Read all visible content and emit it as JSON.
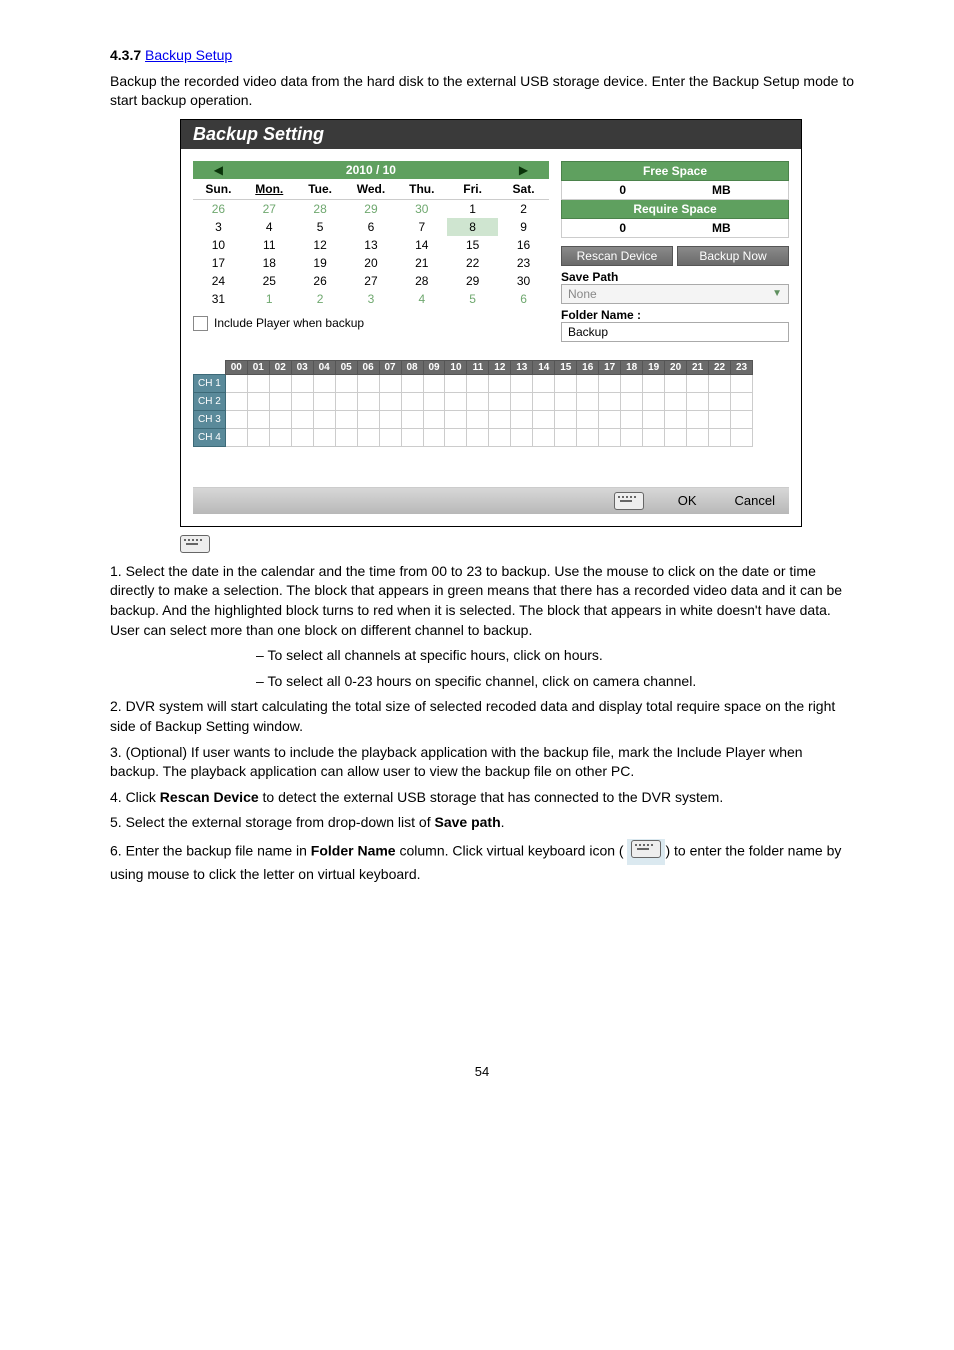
{
  "section": {
    "number": "4.3.7",
    "title_link": "Backup Setup"
  },
  "intro": "Backup the recorded video data from the hard disk to the external USB storage device. Enter the Backup Setup mode to start backup operation.",
  "screenshot": {
    "title": "Backup Setting",
    "calendar": {
      "month_label": "2010 / 10",
      "days": [
        "Sun.",
        "Mon.",
        "Tue.",
        "Wed.",
        "Thu.",
        "Fri.",
        "Sat."
      ],
      "rows": [
        [
          {
            "n": "26",
            "o": true
          },
          {
            "n": "27",
            "o": true
          },
          {
            "n": "28",
            "o": true
          },
          {
            "n": "29",
            "o": true
          },
          {
            "n": "30",
            "o": true
          },
          {
            "n": "1"
          },
          {
            "n": "2"
          }
        ],
        [
          {
            "n": "3"
          },
          {
            "n": "4"
          },
          {
            "n": "5"
          },
          {
            "n": "6"
          },
          {
            "n": "7"
          },
          {
            "n": "8",
            "sel": true
          },
          {
            "n": "9"
          }
        ],
        [
          {
            "n": "10"
          },
          {
            "n": "11"
          },
          {
            "n": "12"
          },
          {
            "n": "13"
          },
          {
            "n": "14"
          },
          {
            "n": "15"
          },
          {
            "n": "16"
          }
        ],
        [
          {
            "n": "17"
          },
          {
            "n": "18"
          },
          {
            "n": "19"
          },
          {
            "n": "20"
          },
          {
            "n": "21"
          },
          {
            "n": "22"
          },
          {
            "n": "23"
          }
        ],
        [
          {
            "n": "24"
          },
          {
            "n": "25"
          },
          {
            "n": "26"
          },
          {
            "n": "27"
          },
          {
            "n": "28"
          },
          {
            "n": "29"
          },
          {
            "n": "30"
          }
        ],
        [
          {
            "n": "31"
          },
          {
            "n": "1",
            "o": true
          },
          {
            "n": "2",
            "o": true
          },
          {
            "n": "3",
            "o": true
          },
          {
            "n": "4",
            "o": true
          },
          {
            "n": "5",
            "o": true
          },
          {
            "n": "6",
            "o": true
          }
        ]
      ]
    },
    "include_player_label": "Include Player when backup",
    "free_space_label": "Free Space",
    "free_space_value": "0",
    "free_space_unit": "MB",
    "require_space_label": "Require Space",
    "require_space_value": "0",
    "require_space_unit": "MB",
    "rescan_btn": "Rescan Device",
    "backup_now_btn": "Backup Now",
    "save_path_label": "Save Path",
    "save_path_value": "None",
    "folder_name_label": "Folder Name :",
    "folder_name_value": "Backup",
    "hours": [
      "00",
      "01",
      "02",
      "03",
      "04",
      "05",
      "06",
      "07",
      "08",
      "09",
      "10",
      "11",
      "12",
      "13",
      "14",
      "15",
      "16",
      "17",
      "18",
      "19",
      "20",
      "21",
      "22",
      "23"
    ],
    "channels": [
      "CH 1",
      "CH 2",
      "CH 3",
      "CH 4"
    ],
    "footer": {
      "ok": "OK",
      "cancel": "Cancel"
    }
  },
  "body": {
    "p1": "1. Select the date in the calendar and the time from 00 to 23 to backup. Use the mouse to click on the date or time directly to make a selection. The block that appears in green means that there has a recorded video data and it can be backup. And the highlighted block turns to red when it is selected. The block that appears in white doesn't have data. User can select more than one block on different channel to backup.",
    "bullet1_dash": "–",
    "bullet1": "To select all channels at specific hours, click on hours.",
    "bullet2_dash": "–",
    "bullet2": "To select all 0-23 hours on specific channel, click on camera channel.",
    "p2": "2. DVR system will start calculating the total size of selected recoded data and display total require space on the right side of Backup Setting window.",
    "p3": "3. (Optional) If user wants to include the playback application with the backup file, mark the Include Player when backup. The playback application can allow user to view the backup file on other PC.",
    "p4_1": "4. Click ",
    "p4_b": "Rescan Device",
    "p4_2": " to detect the external USB storage that has connected to the DVR system.",
    "p5_1": "5. Select the external storage from drop-down list of ",
    "p5_b": "Save path",
    "p5_2": ".",
    "p6_1": "6. Enter the backup file name in ",
    "p6_b": "Folder Name",
    "p6_2": " column. Click virtual keyboard icon (",
    "p6_3": ") to enter the folder name by using mouse to click the letter on virtual keyboard."
  },
  "page_number": "54"
}
